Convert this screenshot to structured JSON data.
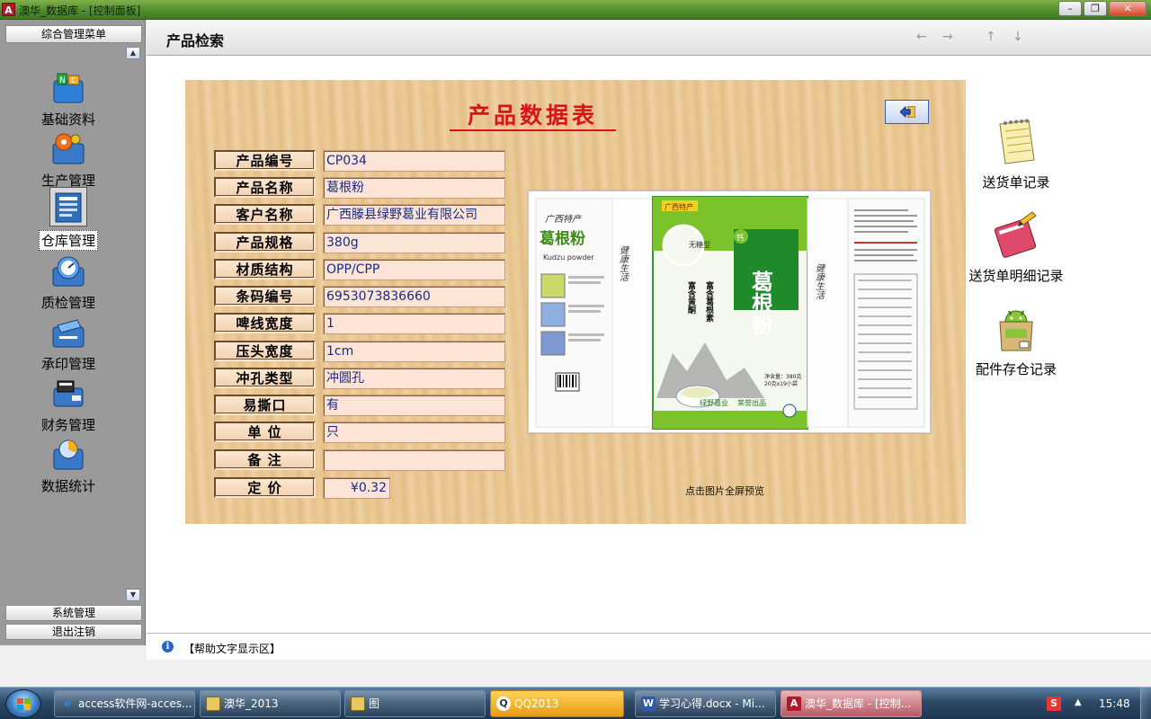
{
  "window": {
    "title": "澳华_数据库 - [控制面板]",
    "app_icon": "A",
    "minimize_icon": "minimize-icon",
    "maximize_icon": "restore-icon",
    "close_icon": "close-icon"
  },
  "sidebar": {
    "header": "综合管理菜单",
    "items": [
      {
        "label": "基础资料",
        "icon": "abc-blocks-icon"
      },
      {
        "label": "生产管理",
        "icon": "gear-production-icon"
      },
      {
        "label": "仓库管理",
        "icon": "warehouse-document-icon"
      },
      {
        "label": "质检管理",
        "icon": "quality-gauge-icon"
      },
      {
        "label": "承印管理",
        "icon": "printing-icon"
      },
      {
        "label": "财务管理",
        "icon": "finance-printer-icon"
      },
      {
        "label": "数据统计",
        "icon": "statistics-chart-icon"
      }
    ],
    "bottom": {
      "system": "系统管理",
      "logout": "退出注销"
    }
  },
  "header": {
    "title": "产品检索",
    "arrows": [
      "←",
      "→",
      "↑",
      "↓"
    ]
  },
  "form": {
    "title": "产品数据表",
    "fields": [
      {
        "label": "产品编号",
        "value": "CP034"
      },
      {
        "label": "产品名称",
        "value": "葛根粉"
      },
      {
        "label": "客户名称",
        "value": "广西滕县绿野葛业有限公司"
      },
      {
        "label": "产品规格",
        "value": "380g"
      },
      {
        "label": "材质结构",
        "value": "OPP/CPP"
      },
      {
        "label": "条码编号",
        "value": "6953073836660"
      },
      {
        "label": "啤线宽度",
        "value": "1"
      },
      {
        "label": "压头宽度",
        "value": "1cm"
      },
      {
        "label": "冲孔类型",
        "value": "冲圆孔"
      },
      {
        "label": "易撕口",
        "value": "有"
      },
      {
        "label": "单  位",
        "value": "只"
      },
      {
        "label": "备  注",
        "value": ""
      },
      {
        "label": "定  价",
        "value": "¥0.32"
      }
    ],
    "image_caption": "点击图片全屏预览",
    "packaging": {
      "region": "广西特产",
      "brand_script": "广西特产",
      "product": "葛根粉",
      "english": "Kudzu powder",
      "sugar_free": "无糖型",
      "calcium": "钙",
      "claims": [
        "富含黄酮",
        "富含葛根素"
      ],
      "big_name": "葛根粉",
      "net_weight": "净含量：380克",
      "bag_count": "20克x19小袋",
      "maker": "绿野葛业",
      "maker_tag": "荣誉出品",
      "side_script": "健康生活"
    }
  },
  "quick_links": [
    {
      "label": "送货单记录",
      "icon": "notepad-icon"
    },
    {
      "label": "送货单明细记录",
      "icon": "edit-pencil-icon"
    },
    {
      "label": "配件存仓记录",
      "icon": "android-store-icon"
    }
  ],
  "help": {
    "text": "【帮助文字显示区】"
  },
  "taskbar": {
    "items": [
      {
        "label": "access软件网-acces...",
        "icon": "ie-icon"
      },
      {
        "label": "澳华_2013",
        "icon": "folder-icon"
      },
      {
        "label": "图",
        "icon": "folder-icon"
      },
      {
        "label": "QQ2013",
        "icon": "qq-icon"
      },
      {
        "label": "学习心得.docx - Mi...",
        "icon": "word-icon"
      },
      {
        "label": "澳华_数据库 - [控制...",
        "icon": "access-icon"
      }
    ],
    "clock": "15:48",
    "tray_icon": "S"
  },
  "colors": {
    "title_red": "#d8141a",
    "value_text": "#1a2a8a",
    "panel_wood": "#e8c48e",
    "titlebar_green": "#4f8a2c"
  }
}
